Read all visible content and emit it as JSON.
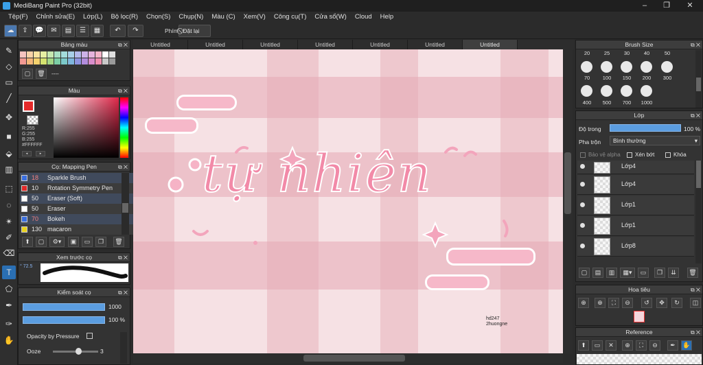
{
  "window": {
    "title": "MediBang Paint Pro (32bit)",
    "min": "–",
    "max": "❐",
    "close": "✕"
  },
  "menu": [
    "Tệp(F)",
    "Chỉnh sửa(E)",
    "Lớp(L)",
    "Bộ lọc(R)",
    "Chọn(S)",
    "Chụp(N)",
    "Màu (C)",
    "Xem(V)",
    "Công cụ(T)",
    "Cửa sổ(W)",
    "Cloud",
    "Help"
  ],
  "toolbar": {
    "shortcut_label": "Phím",
    "reset_label": "Đặt lại"
  },
  "tabs": [
    "Untitled",
    "Untitled",
    "Untitled",
    "Untitled",
    "Untitled",
    "Untitled",
    "Untitled"
  ],
  "palette_panel": {
    "title": "Bảng màu",
    "dash": "----"
  },
  "color_panel": {
    "title": "Màu",
    "r": "R:255",
    "g": "G:255",
    "b": "B:255",
    "hex": "#FFFFFF"
  },
  "brush_panel": {
    "title": "Cọ: Mapping Pen",
    "items": [
      {
        "size": "18",
        "name": "Sparkle Brush",
        "color": "#3a6fe0"
      },
      {
        "size": "10",
        "name": "Rotation Symmetry Pen",
        "color": "#e02a2a"
      },
      {
        "size": "50",
        "name": "Eraser (Soft)",
        "color": "#ffffff"
      },
      {
        "size": "50",
        "name": "Eraser",
        "color": "#ffffff"
      },
      {
        "size": "70",
        "name": "Bokeh",
        "color": "#3a6fe0"
      },
      {
        "size": "130",
        "name": "macaron",
        "color": "#e8d21e"
      }
    ]
  },
  "preview_panel": {
    "title": "Xem trước cọ",
    "value": "72.5"
  },
  "brush_control": {
    "title": "Kiểm soát cọ",
    "size_value": "1000",
    "opacity_value": "100 %",
    "opacity_pressure_label": "Opacity by Pressure",
    "ooze_label": "Ooze",
    "ooze_value": "3"
  },
  "brush_size_panel": {
    "title": "Brush Size",
    "top_row": [
      "20",
      "25",
      "30",
      "40",
      "50"
    ],
    "row2": [
      "70",
      "100",
      "150",
      "200",
      "300"
    ],
    "row3": [
      "400",
      "500",
      "700",
      "1000"
    ]
  },
  "layer_panel": {
    "title": "Lớp",
    "opacity_label": "Độ trong",
    "opacity_value": "100 %",
    "opacity_fraction": 1.0,
    "blend_label": "Pha trộn",
    "blend_value": "Bình thường",
    "protect_alpha": "Bảo vệ alpha",
    "clipping": "Xén bớt",
    "lock": "Khóa",
    "layers": [
      "Lớp4",
      "Lớp4",
      "Lớp1",
      "Lớp1",
      "Lớp8"
    ]
  },
  "navigator_panel": {
    "title": "Hoa tiêu"
  },
  "reference_panel": {
    "title": "Reference"
  },
  "canvas": {
    "text": "tự nhiên",
    "credit1": "hd247",
    "credit2": "2huongne"
  },
  "colors": {
    "accent": "#4a90d9",
    "panel": "#333333",
    "canvas_pink": "#f6b8c9"
  }
}
